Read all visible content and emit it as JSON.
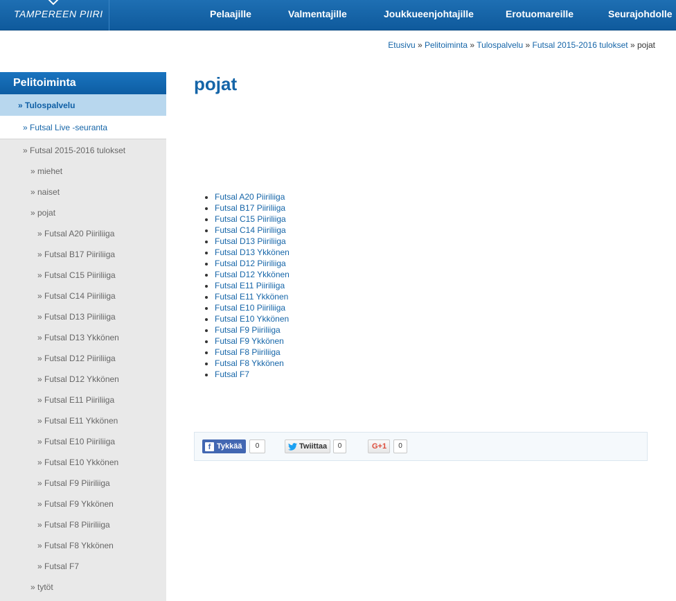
{
  "header": {
    "logo": "TAMPEREEN PIIRI",
    "nav": [
      "Pelaajille",
      "Valmentajille",
      "Joukkueenjohtajille",
      "Erotuomareille",
      "Seurajohdolle"
    ]
  },
  "breadcrumb": {
    "items": [
      "Etusivu",
      "Pelitoiminta",
      "Tulospalvelu",
      "Futsal 2015-2016 tulokset"
    ],
    "current": "pojat",
    "separator": "»"
  },
  "sidebar": {
    "heading": "Pelitoiminta",
    "active": "» Tulospalvelu",
    "live": "» Futsal Live -seuranta",
    "season": "» Futsal 2015-2016 tulokset",
    "groups": [
      "» miehet",
      "» naiset",
      "» pojat"
    ],
    "leagues": [
      "» Futsal A20 Piiriliiga",
      "» Futsal B17 Piiriliiga",
      "» Futsal C15 Piiriliiga",
      "» Futsal C14 Piiriliiga",
      "» Futsal D13 Piiriliiga",
      "» Futsal D13 Ykkönen",
      "» Futsal D12 Piiriliiga",
      "» Futsal D12 Ykkönen",
      "» Futsal E11 Piiriliiga",
      "» Futsal E11 Ykkönen",
      "» Futsal E10 Piiriliiga",
      "» Futsal E10 Ykkönen",
      "» Futsal F9 Piiriliiga",
      "» Futsal F9 Ykkönen",
      "» Futsal F8 Piiriliiga",
      "» Futsal F8 Ykkönen",
      "» Futsal F7"
    ],
    "last": "» tytöt"
  },
  "main": {
    "title": "pojat",
    "links": [
      "Futsal A20 Piiriliiga",
      "Futsal B17 Piiriliiga",
      "Futsal C15 Piiriliiga",
      "Futsal C14 Piiriliiga",
      "Futsal D13 Piiriliiga",
      "Futsal D13 Ykkönen",
      "Futsal D12 Piiriliiga",
      "Futsal D12 Ykkönen",
      "Futsal E11 Piiriliiga",
      "Futsal E11 Ykkönen",
      "Futsal E10 Piiriliiga",
      "Futsal E10 Ykkönen",
      "Futsal F9 Piiriliiga",
      "Futsal F9 Ykkönen",
      "Futsal F8 Piiriliiga",
      "Futsal F8 Ykkönen",
      "Futsal F7"
    ]
  },
  "share": {
    "facebook": {
      "icon": "f",
      "label": "Tykkää",
      "count": "0"
    },
    "twitter": {
      "label": "Twiittaa",
      "count": "0"
    },
    "gplus": {
      "label": "G+1",
      "count": "0"
    }
  },
  "colors": {
    "brand": "#0f5a9c",
    "link": "#1565a8",
    "sidebar_bg": "#e9e9e9",
    "active_bg": "#b8d7ee"
  }
}
